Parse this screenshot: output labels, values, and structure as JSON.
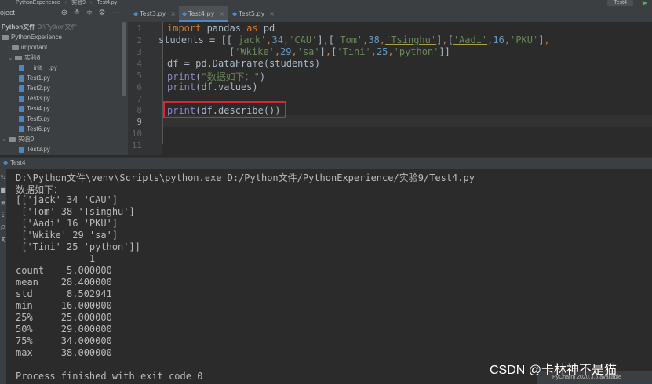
{
  "breadcrumb": [
    "PythonExperience",
    "实验9",
    "Test4.py"
  ],
  "run_config": "Test4",
  "project_panel": {
    "title": "oject",
    "tree": [
      {
        "label": "Python文件",
        "path": "D:\\Python文件",
        "kind": "root"
      },
      {
        "label": "PythonExperience",
        "kind": "folder"
      },
      {
        "label": "important",
        "kind": "folder"
      },
      {
        "label": "实验8",
        "kind": "folder"
      },
      {
        "label": "__init__.py",
        "kind": "file"
      },
      {
        "label": "Test1.py",
        "kind": "file"
      },
      {
        "label": "Test2.py",
        "kind": "file"
      },
      {
        "label": "Test3.py",
        "kind": "file"
      },
      {
        "label": "Test4.py",
        "kind": "file"
      },
      {
        "label": "Test5.py",
        "kind": "file"
      },
      {
        "label": "Test6.py",
        "kind": "file"
      },
      {
        "label": "实验9",
        "kind": "folder"
      },
      {
        "label": "Test3.py",
        "kind": "file"
      }
    ]
  },
  "editor_tabs": [
    {
      "label": "Test3.py",
      "active": false
    },
    {
      "label": "Test4.py",
      "active": true
    },
    {
      "label": "Test5.py",
      "active": false
    }
  ],
  "editor": {
    "line_numbers": [
      "1",
      "2",
      "3",
      "4",
      "5",
      "6",
      "7",
      "8",
      "9",
      "10",
      "11"
    ],
    "current_line": "9"
  },
  "run_panel": {
    "tab_label": "Test4",
    "output": {
      "command": "D:\\Python文件\\venv\\Scripts\\python.exe D:/Python文件/PythonExperience/实验9/Test4.py",
      "header": "数据如下：",
      "values": [
        "[['jack' 34 'CAU']",
        " ['Tom' 38 'Tsinghu']",
        " ['Aadi' 16 'PKU']",
        " ['Wkike' 29 'sa']",
        " ['Tini' 25 'python']]"
      ],
      "describe_col": "             1",
      "describe": [
        "count    5.000000",
        "mean    28.400000",
        "std      8.502941",
        "min     16.000000",
        "25%     25.000000",
        "50%     29.000000",
        "75%     34.000000",
        "max     38.000000"
      ],
      "exit": "Process finished with exit code 0"
    }
  },
  "watermark": "CSDN @卡林神不是猫",
  "status_tip": "PyCharm 2020.3.5 available",
  "colors": {
    "highlight_box": "#e0242b",
    "keyword": "#cc7832",
    "string": "#6a8759",
    "number": "#6897bb"
  }
}
